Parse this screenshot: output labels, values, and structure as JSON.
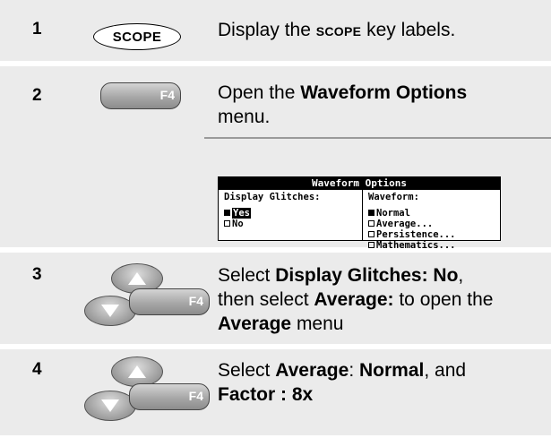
{
  "steps": [
    {
      "num": "1",
      "key_label": "SCOPE",
      "text": {
        "pre": "Display the ",
        "sc": "SCOPE",
        "post": " key labels."
      }
    },
    {
      "num": "2",
      "key_label": "F4",
      "text": {
        "pre": "Open the ",
        "bold": "Waveform Options",
        "post": " menu."
      },
      "menu": {
        "title": "Waveform Options",
        "left_header": "Display Glitches:",
        "left_options": [
          {
            "label": "Yes",
            "selected": true
          },
          {
            "label": "No",
            "selected": false
          }
        ],
        "right_header": "Waveform:",
        "right_options": [
          {
            "label": "Normal",
            "selected": true
          },
          {
            "label": "Average...",
            "selected": false
          },
          {
            "label": "Persistence...",
            "selected": false
          },
          {
            "label": "Mathematics...",
            "selected": false
          }
        ]
      }
    },
    {
      "num": "3",
      "key_label": "F4",
      "text": {
        "p1": "Select ",
        "b1": "Display Glitches: No",
        "p2": ",",
        "p3": "then select ",
        "b2": "Average:",
        "p4": " to open the",
        "b3": "Average",
        "p5": " menu"
      }
    },
    {
      "num": "4",
      "key_label": "F4",
      "text": {
        "p1": "Select ",
        "b1": "Average",
        "p2": ": ",
        "b2": "Normal",
        "p3": ", and",
        "b3": "Factor :  8x"
      }
    }
  ],
  "colors": {
    "row_bg": "#ebebeb",
    "key_gray": "#a7a7a7"
  }
}
